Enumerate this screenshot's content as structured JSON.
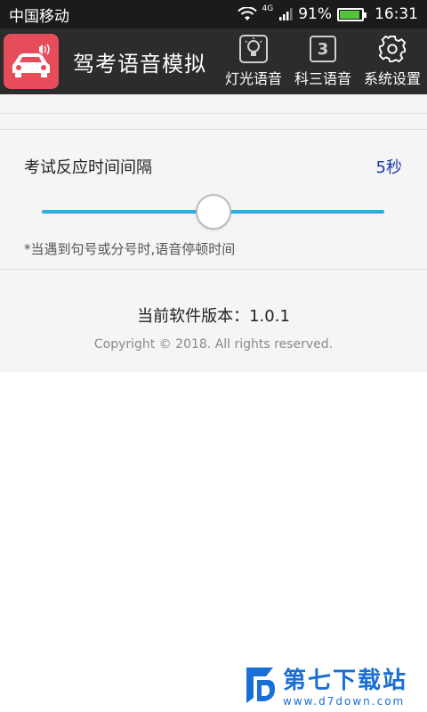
{
  "status_bar": {
    "carrier": "中国移动",
    "network_type": "4G",
    "battery_percent": "91%",
    "time": "16:31"
  },
  "app_bar": {
    "title": "驾考语音模拟",
    "menu": [
      {
        "label": "灯光语音",
        "icon": "lightbulb-icon"
      },
      {
        "label": "科三语音",
        "icon": "number-3-icon",
        "icon_text": "3"
      },
      {
        "label": "系统设置",
        "icon": "gear-icon"
      }
    ]
  },
  "setting": {
    "title": "考试反应时间间隔",
    "value": "5秒",
    "slider_level": 0.5,
    "note": "*当遇到句号或分号时,语音停顿时间"
  },
  "about": {
    "version": "当前软件版本：1.0.1",
    "copyright": "Copyright © 2018. All rights reserved."
  },
  "watermark": {
    "title": "第七下载站",
    "url": "www.d7down.com"
  },
  "colors": {
    "app_bar": "#2c2c2c",
    "logo_bg": "#e74c5b",
    "slider_track": "#2aaee0",
    "value_text": "#1a3aa8",
    "watermark": "#1a6fd6"
  }
}
